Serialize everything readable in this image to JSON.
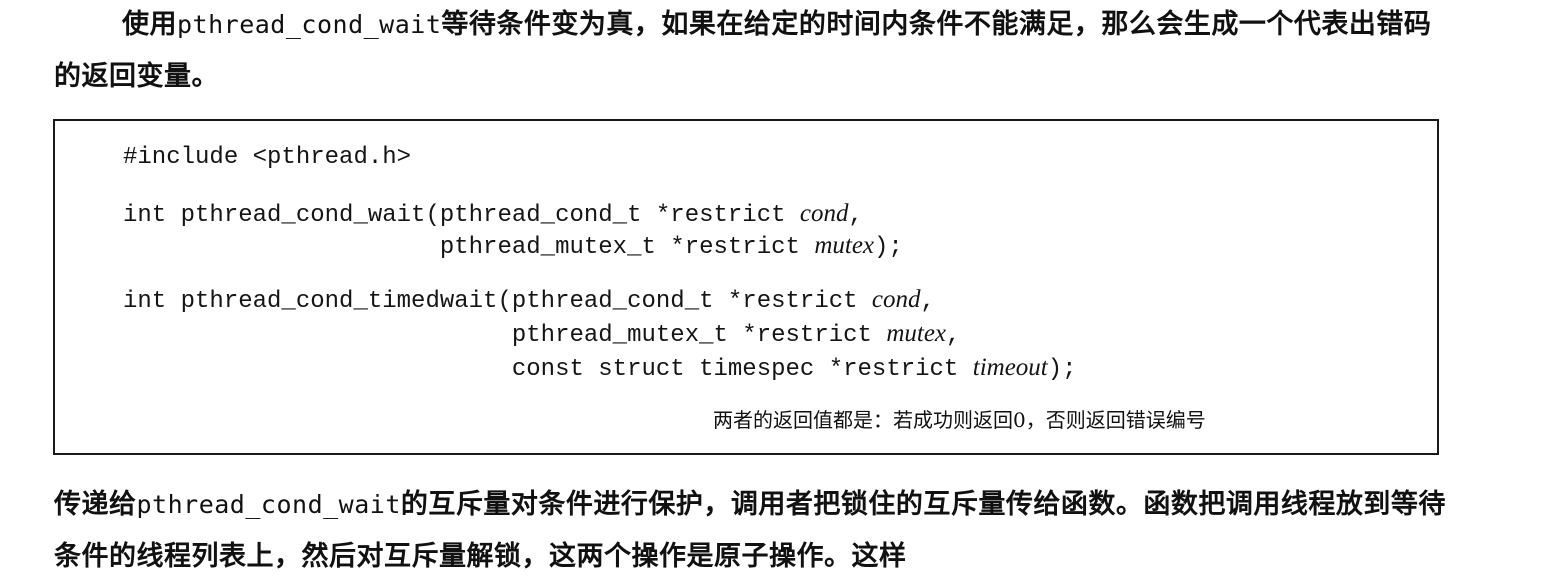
{
  "intro": {
    "prefix": "使用",
    "func": "pthread_cond_wait",
    "suffix": "等待条件变为真，如果在给定的时间内条件不能满足，那么会生成一个代表出错码的返回变量。"
  },
  "code": {
    "include": "#include <pthread.h>",
    "wait_line1_head": "int pthread_cond_wait(pthread_cond_t *restrict ",
    "wait_line1_arg": "cond",
    "wait_line1_tail": ",",
    "wait_line2_head": "                      pthread_mutex_t *restrict ",
    "wait_line2_arg": "mutex",
    "wait_line2_tail": ");",
    "timed_line1_head": "int pthread_cond_timedwait(pthread_cond_t *restrict ",
    "timed_line1_arg": "cond",
    "timed_line1_tail": ",",
    "timed_line2_head": "                           pthread_mutex_t *restrict ",
    "timed_line2_arg": "mutex",
    "timed_line2_tail": ",",
    "timed_line3_head": "                           const struct timespec *restrict ",
    "timed_line3_arg": "timeout",
    "timed_line3_tail": ");",
    "return_note": "两者的返回值都是：若成功则返回0，否则返回错误编号"
  },
  "body": {
    "prefix": "传递给",
    "func": "pthread_cond_wait",
    "suffix": "的互斥量对条件进行保护，调用者把锁住的互斥量传给函数。函数把调用线程放到等待条件的线程列表上，然后对互斥量解锁，这两个操作是原子操作。这样"
  }
}
